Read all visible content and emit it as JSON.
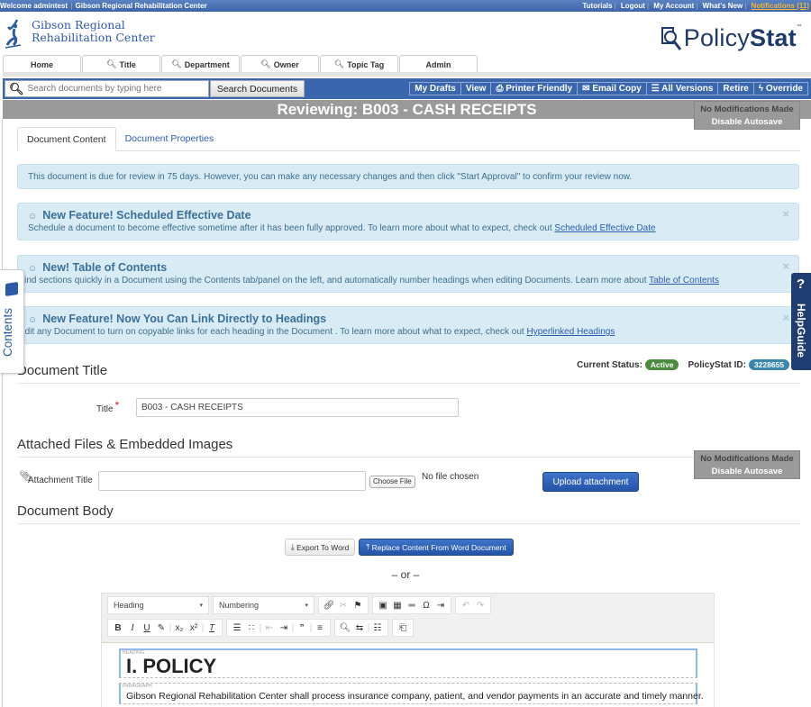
{
  "topbar": {
    "welcome": "Welcome admintest",
    "org": "Gibson Regional Rehabilitation Center",
    "links": [
      "Tutorials",
      "Logout",
      "My Account",
      "What's New"
    ],
    "notifications": "Notifications (11)"
  },
  "header": {
    "org_line1": "Gibson Regional",
    "org_line2": "Rehabilitation Center",
    "brand_light": "Policy",
    "brand_bold": "Stat",
    "brand_tm": "™"
  },
  "nav": {
    "tabs": [
      {
        "label": "Home",
        "search": false
      },
      {
        "label": "Title",
        "search": true
      },
      {
        "label": "Department",
        "search": true
      },
      {
        "label": "Owner",
        "search": true
      },
      {
        "label": "Topic Tag",
        "search": true
      },
      {
        "label": "Admin",
        "search": false
      }
    ]
  },
  "search": {
    "placeholder": "Search documents by typing here",
    "button": "Search Documents"
  },
  "actions": [
    {
      "label": "My Drafts",
      "icon": ""
    },
    {
      "label": "View",
      "icon": ""
    },
    {
      "label": "Printer Friendly",
      "icon": "printer-icon"
    },
    {
      "label": "Email Copy",
      "icon": "envelope-icon"
    },
    {
      "label": "All Versions",
      "icon": "list-icon"
    },
    {
      "label": "Retire",
      "icon": ""
    },
    {
      "label": "Override",
      "icon": "bolt-icon"
    }
  ],
  "review_title": "Reviewing: B003 - CASH RECEIPTS",
  "autosave": {
    "status": "No Modifications Made",
    "action": "Disable Autosave"
  },
  "doc_tabs": [
    "Document Content",
    "Document Properties"
  ],
  "alerts": {
    "info": "This document is due for review in 75 days. However, you can make any necessary changes and then click \"Start Approval\" to confirm your review now.",
    "features": [
      {
        "title": "New Feature! Scheduled Effective Date",
        "body": "Schedule a document to become effective sometime after it has been fully approved. To learn more about what to expect, check out ",
        "link": "Scheduled Effective Date"
      },
      {
        "title": "New! Table of Contents",
        "body": "Find sections quickly in a Document using the Contents tab/panel on the left, and automatically number headings when editing Documents. Learn more about ",
        "link": "Table of Contents"
      },
      {
        "title": "New Feature! Now You Can Link Directly to Headings",
        "body": "Edit any Document to turn on copyable links for each heading in the Document . To learn more about what to expect, check out ",
        "link": "Hyperlinked Headings"
      }
    ],
    "close": "×"
  },
  "side_tabs": {
    "contents": "Contents",
    "help_q": "?",
    "help": "HelpGuide"
  },
  "status": {
    "label": "Current Status:",
    "value": "Active",
    "id_label": "PolicyStat ID:",
    "id_value": "3228655",
    "colors": {
      "active": "#4c8c3f",
      "id": "#3a87ad"
    }
  },
  "sections": {
    "title": "Document Title",
    "attachments": "Attached Files & Embedded Images",
    "body": "Document Body"
  },
  "title_field": {
    "label": "Title",
    "required": "*",
    "value": "B003 - CASH RECEIPTS"
  },
  "attachment": {
    "label": "Attachment Title",
    "value": "",
    "choose": "Choose File",
    "no_file": "No file chosen",
    "upload": "Upload attachment"
  },
  "word": {
    "export": "Export To Word",
    "replace": "Replace Content From Word Document",
    "or": "– or –"
  },
  "editor": {
    "style_select": "Heading",
    "numbering_select": "Numbering",
    "blocks": [
      {
        "tag": "HEADING",
        "text": "I. POLICY"
      },
      {
        "tag": "PARAGRAPH",
        "text": "Gibson Regional Rehabilitation Center shall process insurance company, patient, and vendor payments in an accurate and timely manner."
      }
    ]
  },
  "colors": {
    "brand_blue": "#3a66ae",
    "nav_dark": "#1f3d70",
    "alert_bg": "#d9ebf5",
    "review_bar": "#9a9a9a"
  }
}
